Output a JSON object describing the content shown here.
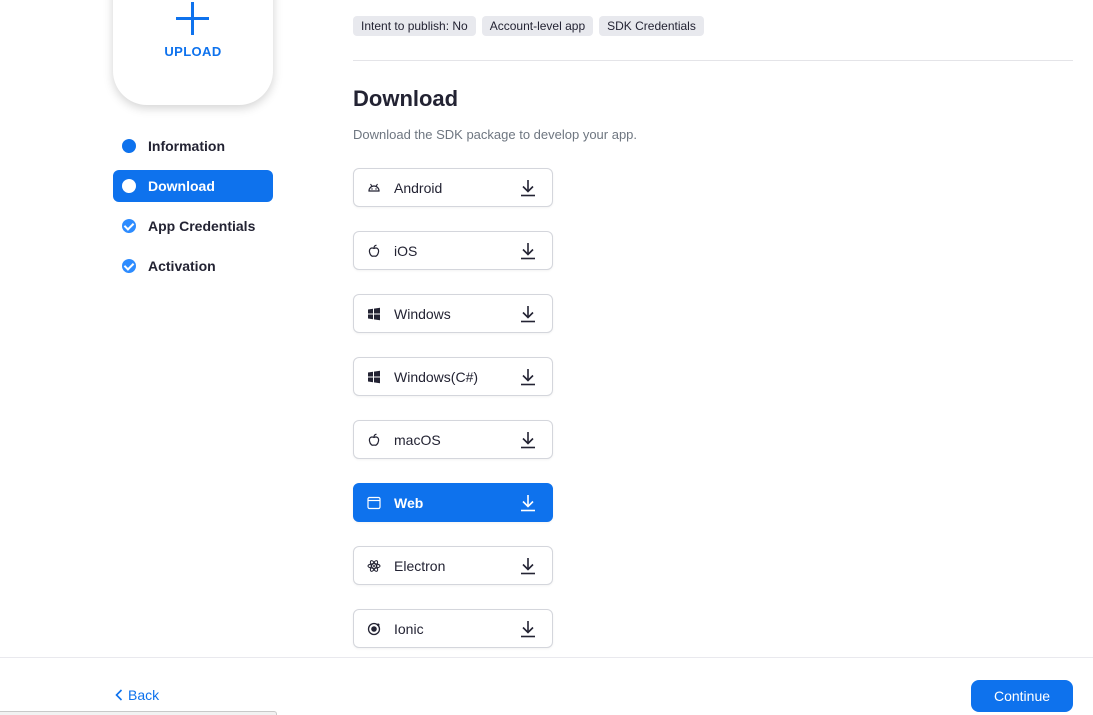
{
  "upload": {
    "label": "UPLOAD"
  },
  "steps": [
    {
      "label": "Information"
    },
    {
      "label": "Download"
    },
    {
      "label": "App Credentials"
    },
    {
      "label": "Activation"
    }
  ],
  "tags": [
    "Intent to publish: No",
    "Account-level app",
    "SDK Credentials"
  ],
  "section": {
    "title": "Download",
    "subtitle": "Download the SDK package to develop your app."
  },
  "platforms": [
    {
      "label": "Android",
      "icon": "android-icon"
    },
    {
      "label": "iOS",
      "icon": "apple-icon"
    },
    {
      "label": "Windows",
      "icon": "windows-icon"
    },
    {
      "label": "Windows(C#)",
      "icon": "windows-icon"
    },
    {
      "label": "macOS",
      "icon": "apple-icon"
    },
    {
      "label": "Web",
      "icon": "browser-window-icon",
      "selected": true
    },
    {
      "label": "Electron",
      "icon": "electron-icon"
    },
    {
      "label": "Ionic",
      "icon": "ionic-icon"
    }
  ],
  "footer": {
    "back_label": "Back",
    "continue_label": "Continue"
  },
  "colors": {
    "accent": "#0e72ed",
    "text": "#232333",
    "muted": "#6e7680"
  }
}
